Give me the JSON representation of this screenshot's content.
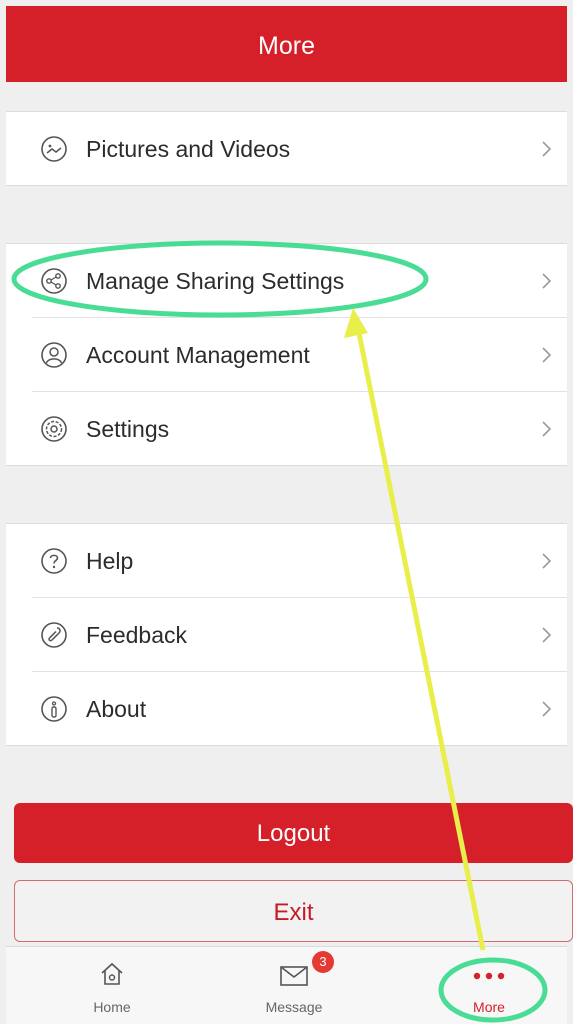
{
  "header": {
    "title": "More"
  },
  "groups": [
    {
      "items": [
        {
          "label": "Pictures and Videos",
          "icon": "pictures-icon"
        }
      ]
    },
    {
      "items": [
        {
          "label": "Manage Sharing Settings",
          "icon": "share-icon"
        },
        {
          "label": "Account Management",
          "icon": "account-icon"
        },
        {
          "label": "Settings",
          "icon": "settings-icon"
        }
      ]
    },
    {
      "items": [
        {
          "label": "Help",
          "icon": "help-icon"
        },
        {
          "label": "Feedback",
          "icon": "feedback-icon"
        },
        {
          "label": "About",
          "icon": "about-icon"
        }
      ]
    }
  ],
  "buttons": {
    "logout": "Logout",
    "exit": "Exit"
  },
  "tabbar": {
    "tabs": [
      {
        "label": "Home",
        "icon": "home-icon"
      },
      {
        "label": "Message",
        "icon": "message-icon",
        "badge": "3"
      },
      {
        "label": "More",
        "icon": "more-icon",
        "active": true
      }
    ]
  },
  "colors": {
    "brand": "#d5202a",
    "highlight": "#35d889",
    "arrow": "#e8ee4a"
  }
}
